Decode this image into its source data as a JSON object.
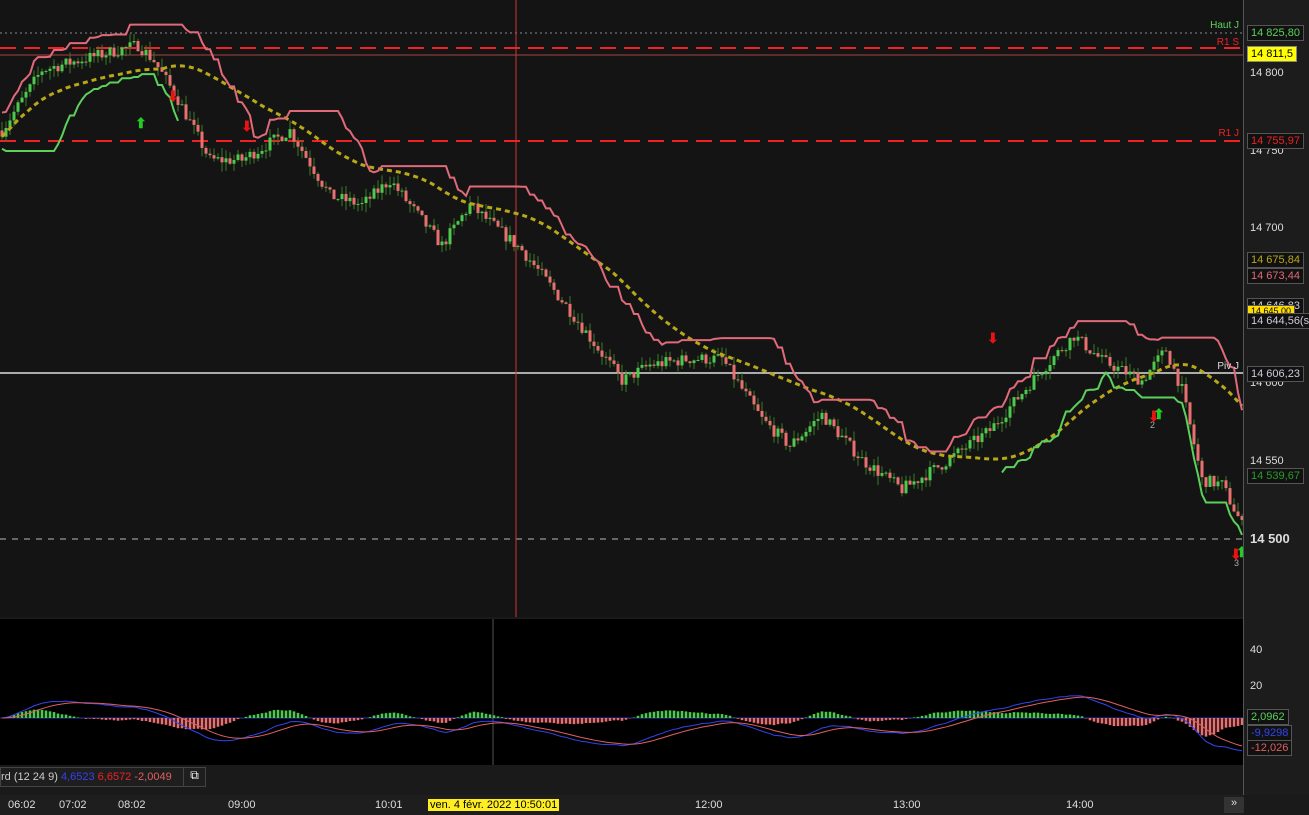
{
  "price_axis": {
    "ticks": [
      "14 800",
      "14 750",
      "14 700",
      "14 600",
      "14 550",
      "14 500"
    ]
  },
  "levels": {
    "haut_j": "Haut J",
    "r1_s": "R1 S",
    "r1_j": "R1 J",
    "piv_j": "Piv J"
  },
  "tags": {
    "haut_j": "14 825,80",
    "current": "14 811,5",
    "r1_j": "14 755,97",
    "ma": "14 675,84",
    "upper": "14 673,44",
    "t1": "14 646,83",
    "t2": "14 645,00",
    "t3": "14 644,56(s",
    "piv": "14 606,23",
    "lower": "14 539,67"
  },
  "osc_axis": {
    "ticks": [
      "40",
      "20"
    ],
    "tags": {
      "hist": "2,0962",
      "macd": "-9,9298",
      "signal": "-12,026"
    }
  },
  "legend": {
    "name": "rd (12 24 9)",
    "v1": "4,6523",
    "v2": "6,6572",
    "v3": "-2,0049"
  },
  "time_axis": {
    "labels": [
      "06:02",
      "07:02",
      "08:02",
      "09:00",
      "10:01",
      "12:00",
      "13:00",
      "14:00"
    ],
    "cursor": "ven. 4 févr. 2022 10:50:01",
    "scroll": "»"
  },
  "signals": {
    "a": "2",
    "b": "3"
  },
  "colors": {
    "up": "#4ec94e",
    "down": "#e87070",
    "ma": "#b8a818",
    "stop_up": "#5bd15b",
    "stop_down": "#e06a7a"
  },
  "chart_data": {
    "type": "candlestick",
    "ylim": [
      14418,
      14847
    ],
    "path": [
      [
        0,
        14763
      ],
      [
        10,
        14802
      ],
      [
        34,
        14818
      ],
      [
        38,
        14808
      ],
      [
        44,
        14783
      ],
      [
        52,
        14744
      ],
      [
        60,
        14744
      ],
      [
        72,
        14763
      ],
      [
        82,
        14721
      ],
      [
        90,
        14715
      ],
      [
        97,
        14731
      ],
      [
        110,
        14689
      ],
      [
        117,
        14715
      ],
      [
        130,
        14686
      ],
      [
        142,
        14647
      ],
      [
        155,
        14602
      ],
      [
        162,
        14612
      ],
      [
        172,
        14616
      ],
      [
        180,
        14616
      ],
      [
        190,
        14577
      ],
      [
        197,
        14560
      ],
      [
        205,
        14580
      ],
      [
        215,
        14551
      ],
      [
        225,
        14532
      ],
      [
        235,
        14548
      ],
      [
        247,
        14570
      ],
      [
        260,
        14609
      ],
      [
        268,
        14631
      ],
      [
        275,
        14615
      ],
      [
        285,
        14602
      ],
      [
        291,
        14622
      ],
      [
        295,
        14596
      ],
      [
        300,
        14538
      ],
      [
        305,
        14535
      ],
      [
        310,
        14509
      ]
    ],
    "osc_range": [
      -30,
      50
    ]
  }
}
